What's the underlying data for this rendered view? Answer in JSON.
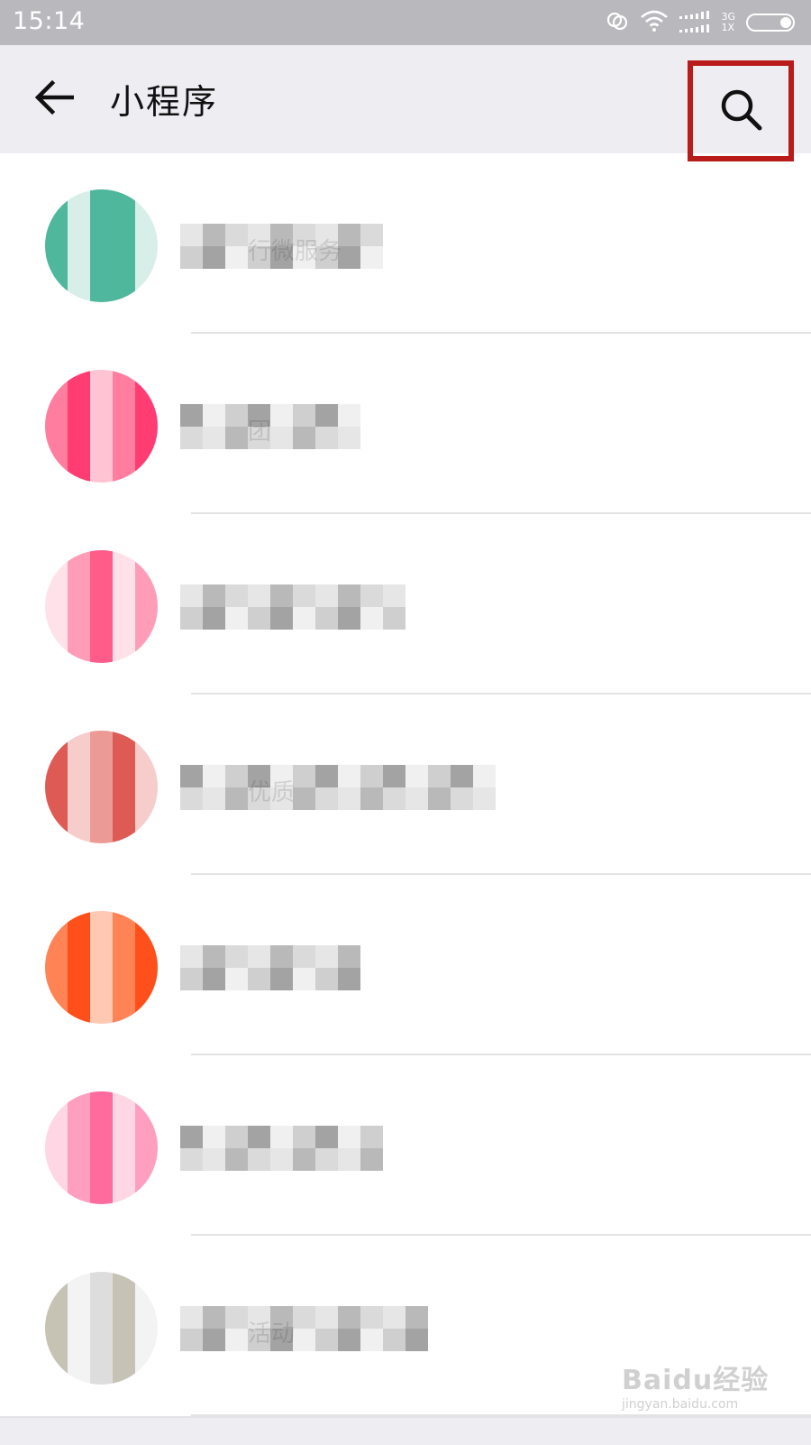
{
  "status_bar": {
    "time": "15:14",
    "network_top": "3G",
    "network_bottom": "1X",
    "icons": [
      "hd-call-icon",
      "wifi-icon",
      "signal-icon",
      "battery-icon"
    ]
  },
  "header": {
    "title": "小程序",
    "back_icon": "arrow-left-icon",
    "search_icon": "search-icon",
    "highlight_color": "#b81b1a"
  },
  "list": {
    "items": [
      {
        "name_visible": "行微服务",
        "avatar_palette": [
          "#4fb79c",
          "#8fd0be",
          "#d7efe8"
        ],
        "avatar_shape": "teal-mosaic"
      },
      {
        "name_visible": "团",
        "avatar_palette": [
          "#ff3d73",
          "#ff7ea0",
          "#ffc4d3"
        ],
        "avatar_shape": "red-pink-mosaic"
      },
      {
        "name_visible": "",
        "avatar_palette": [
          "#ff5c8a",
          "#ff9db8",
          "#ffe1ea"
        ],
        "avatar_shape": "pink-mosaic"
      },
      {
        "name_visible": "优质",
        "avatar_palette": [
          "#de5a55",
          "#ec9a96",
          "#f6cdca"
        ],
        "avatar_shape": "red-mosaic"
      },
      {
        "name_visible": "",
        "avatar_palette": [
          "#ff4f1a",
          "#ff8355",
          "#ffc8b3"
        ],
        "avatar_shape": "orange-mosaic"
      },
      {
        "name_visible": "",
        "avatar_palette": [
          "#ff6b9c",
          "#ff9fbf",
          "#ffd6e4"
        ],
        "avatar_shape": "pink-mosaic-2"
      },
      {
        "name_visible": "活动",
        "avatar_palette": [
          "#c6c3b5",
          "#dddddd",
          "#f3f3f3"
        ],
        "avatar_shape": "gray-mosaic"
      }
    ]
  },
  "watermark": {
    "brand": "Baidu经验",
    "url": "jingyan.baidu.com"
  }
}
